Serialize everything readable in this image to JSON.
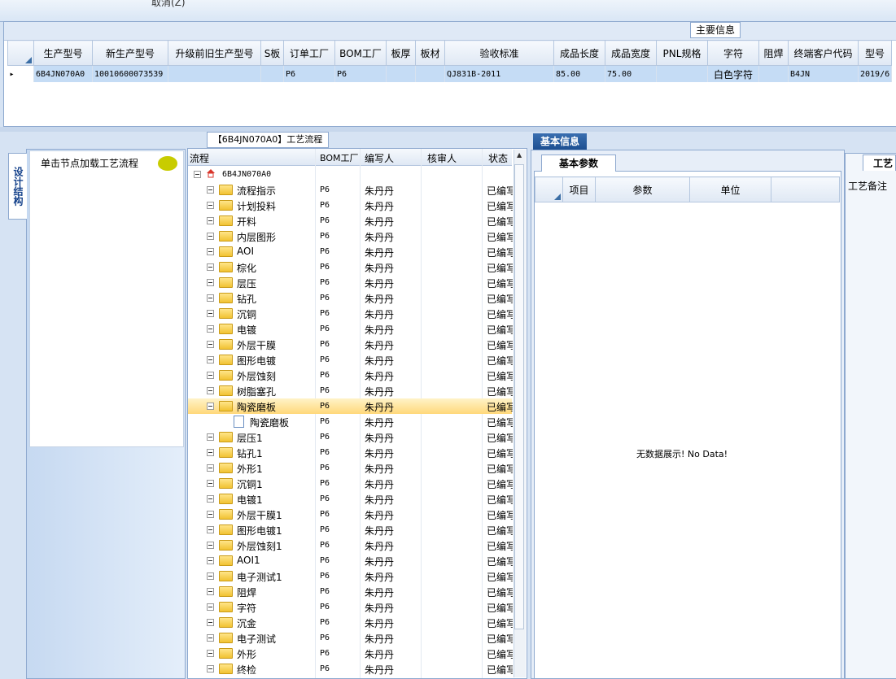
{
  "toolbar": {
    "cancel_label": "取消(Z)"
  },
  "main_info": {
    "title": "主要信息",
    "columns": [
      "生产型号",
      "新生产型号",
      "升级前旧生产型号",
      "S板",
      "订单工厂",
      "BOM工厂",
      "板厚",
      "板材",
      "验收标准",
      "成品长度",
      "成品宽度",
      "PNL规格",
      "字符",
      "阻焊",
      "终端客户代码",
      "型号"
    ],
    "rows": [
      [
        "6B4JN070A0",
        "10010600073539",
        "",
        "",
        "P6",
        "P6",
        "",
        "",
        "QJ831B-2011",
        "85.00",
        "75.00",
        "",
        "白色字符",
        "",
        "B4JN",
        "2019/6"
      ]
    ]
  },
  "left_panel": {
    "tab_label": "设计结构",
    "load_hint": "单击节点加载工艺流程"
  },
  "process": {
    "title": "【6B4JN070A0】工艺流程",
    "headers": {
      "name": "流程",
      "bom": "BOM工厂",
      "editor": "编写人",
      "reviewer": "核审人",
      "status": "状态"
    },
    "root": "6B4JN070A0",
    "items": [
      {
        "name": "流程指示",
        "bom": "P6",
        "editor": "朱丹丹",
        "status": "已编写"
      },
      {
        "name": "计划投料",
        "bom": "P6",
        "editor": "朱丹丹",
        "status": "已编写"
      },
      {
        "name": "开料",
        "bom": "P6",
        "editor": "朱丹丹",
        "status": "已编写"
      },
      {
        "name": "内层图形",
        "bom": "P6",
        "editor": "朱丹丹",
        "status": "已编写"
      },
      {
        "name": "AOI",
        "bom": "P6",
        "editor": "朱丹丹",
        "status": "已编写"
      },
      {
        "name": "棕化",
        "bom": "P6",
        "editor": "朱丹丹",
        "status": "已编写"
      },
      {
        "name": "层压",
        "bom": "P6",
        "editor": "朱丹丹",
        "status": "已编写"
      },
      {
        "name": "钻孔",
        "bom": "P6",
        "editor": "朱丹丹",
        "status": "已编写"
      },
      {
        "name": "沉铜",
        "bom": "P6",
        "editor": "朱丹丹",
        "status": "已编写"
      },
      {
        "name": "电镀",
        "bom": "P6",
        "editor": "朱丹丹",
        "status": "已编写"
      },
      {
        "name": "外层干膜",
        "bom": "P6",
        "editor": "朱丹丹",
        "status": "已编写"
      },
      {
        "name": "图形电镀",
        "bom": "P6",
        "editor": "朱丹丹",
        "status": "已编写"
      },
      {
        "name": "外层蚀刻",
        "bom": "P6",
        "editor": "朱丹丹",
        "status": "已编写"
      },
      {
        "name": "树脂塞孔",
        "bom": "P6",
        "editor": "朱丹丹",
        "status": "已编写"
      },
      {
        "name": "陶瓷磨板",
        "bom": "P6",
        "editor": "朱丹丹",
        "status": "已编写",
        "selected": true
      },
      {
        "name": "陶瓷磨板",
        "bom": "P6",
        "editor": "朱丹丹",
        "status": "已编写",
        "child": true
      },
      {
        "name": "层压1",
        "bom": "P6",
        "editor": "朱丹丹",
        "status": "已编写"
      },
      {
        "name": "钻孔1",
        "bom": "P6",
        "editor": "朱丹丹",
        "status": "已编写"
      },
      {
        "name": "外形1",
        "bom": "P6",
        "editor": "朱丹丹",
        "status": "已编写"
      },
      {
        "name": "沉铜1",
        "bom": "P6",
        "editor": "朱丹丹",
        "status": "已编写"
      },
      {
        "name": "电镀1",
        "bom": "P6",
        "editor": "朱丹丹",
        "status": "已编写"
      },
      {
        "name": "外层干膜1",
        "bom": "P6",
        "editor": "朱丹丹",
        "status": "已编写"
      },
      {
        "name": "图形电镀1",
        "bom": "P6",
        "editor": "朱丹丹",
        "status": "已编写"
      },
      {
        "name": "外层蚀刻1",
        "bom": "P6",
        "editor": "朱丹丹",
        "status": "已编写"
      },
      {
        "name": "AOI1",
        "bom": "P6",
        "editor": "朱丹丹",
        "status": "已编写"
      },
      {
        "name": "电子测试1",
        "bom": "P6",
        "editor": "朱丹丹",
        "status": "已编写"
      },
      {
        "name": "阻焊",
        "bom": "P6",
        "editor": "朱丹丹",
        "status": "已编写"
      },
      {
        "name": "字符",
        "bom": "P6",
        "editor": "朱丹丹",
        "status": "已编写"
      },
      {
        "name": "沉金",
        "bom": "P6",
        "editor": "朱丹丹",
        "status": "已编写"
      },
      {
        "name": "电子测试",
        "bom": "P6",
        "editor": "朱丹丹",
        "status": "已编写"
      },
      {
        "name": "外形",
        "bom": "P6",
        "editor": "朱丹丹",
        "status": "已编写"
      },
      {
        "name": "终检",
        "bom": "P6",
        "editor": "朱丹丹",
        "status": "已编写"
      }
    ]
  },
  "basic_info": {
    "tab_label": "基本信息",
    "sub_tab_label": "基本参数",
    "columns": [
      "项目",
      "参数",
      "单位"
    ],
    "empty_text": "无数据展示! No Data!"
  },
  "craft": {
    "tab_label": "工艺",
    "note_label": "工艺备注"
  }
}
